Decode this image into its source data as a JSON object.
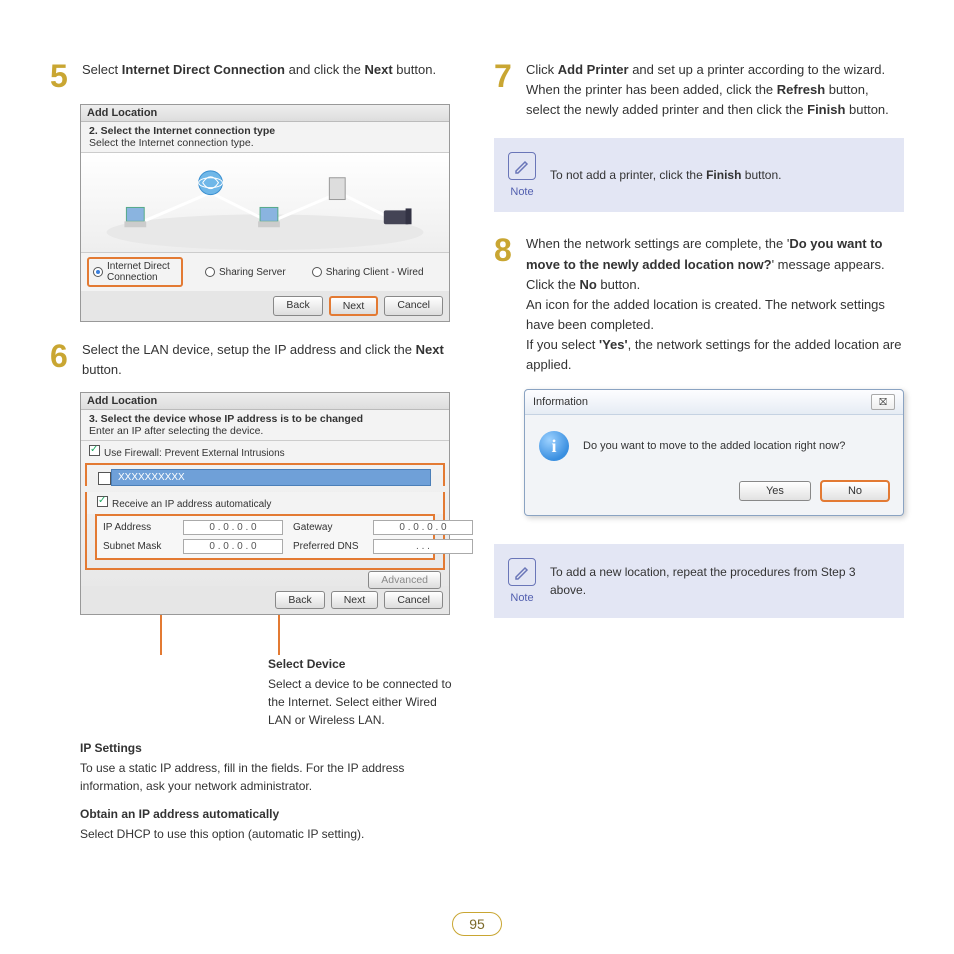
{
  "page_number": "95",
  "left": {
    "step5": {
      "num": "5",
      "text_pre": "Select ",
      "bold1": "Internet Direct Connection",
      "text_mid": " and click the ",
      "bold2": "Next",
      "text_post": " button."
    },
    "dialog5": {
      "title": "Add Location",
      "sub_bold": "2. Select the Internet connection type",
      "sub_text": "Select the Internet connection type.",
      "opt1": "Internet Direct Connection",
      "opt2": "Sharing Server",
      "opt3": "Sharing Client - Wired",
      "back": "Back",
      "next": "Next",
      "cancel": "Cancel"
    },
    "step6": {
      "num": "6",
      "text_pre": "Select the LAN device, setup the IP address and click the ",
      "bold1": "Next",
      "text_post": " button."
    },
    "dialog6": {
      "title": "Add Location",
      "sub_bold": "3. Select the device whose IP address is to be changed",
      "sub_text": "Enter an IP after selecting the device.",
      "firewall": "Use Firewall: Prevent External Intrusions",
      "device": "XXXXXXXXXX",
      "receive": "Receive an IP address automaticaly",
      "ip_label": "IP Address",
      "ip_val": "0 . 0 . 0 . 0",
      "gw_label": "Gateway",
      "gw_val": "0 . 0 . 0 . 0",
      "sn_label": "Subnet Mask",
      "sn_val": "0 . 0 . 0 . 0",
      "dns_label": "Preferred DNS",
      "dns_val": ". . .",
      "advanced": "Advanced",
      "back": "Back",
      "next": "Next",
      "cancel": "Cancel"
    },
    "callout_device_title": "Select Device",
    "callout_device_text": "Select a device to be connected to the Internet. Select either Wired LAN or Wireless LAN.",
    "callout_ip_title": "IP Settings",
    "callout_ip_text": "To use a static IP address, fill in the fields. For the IP address information, ask your network administrator.",
    "callout_auto_title": "Obtain an IP address automatically",
    "callout_auto_text": "Select DHCP to use this option (automatic IP setting)."
  },
  "right": {
    "step7": {
      "num": "7",
      "text_pre": "Click ",
      "bold1": "Add Printer",
      "text_mid1": " and set up a printer according to the wizard. When the printer has been added, click the ",
      "bold2": "Refresh",
      "text_mid2": " button, select the newly added printer and then click the ",
      "bold3": "Finish",
      "text_post": " button."
    },
    "note1": {
      "label": "Note",
      "text_pre": "To not add a printer, click the ",
      "bold": "Finish",
      "text_post": " button."
    },
    "step8": {
      "num": "8",
      "l1_pre": "When the network settings are complete, the '",
      "l1_bold": "Do you want to move to the newly added location now?",
      "l1_mid": "' message appears. Click the ",
      "l1_bold2": "No",
      "l1_post": " button.",
      "l2": "An icon for the added location is created. The network settings have been completed.",
      "l3_pre": "If you select ",
      "l3_bold": "'Yes'",
      "l3_post": ", the network settings for the added location are applied."
    },
    "info_dialog": {
      "title": "Information",
      "close": "⛝",
      "msg": "Do you want to move to the added location right now?",
      "yes": "Yes",
      "no": "No"
    },
    "note2": {
      "label": "Note",
      "text": "To add a new location, repeat the procedures from Step 3 above."
    }
  }
}
